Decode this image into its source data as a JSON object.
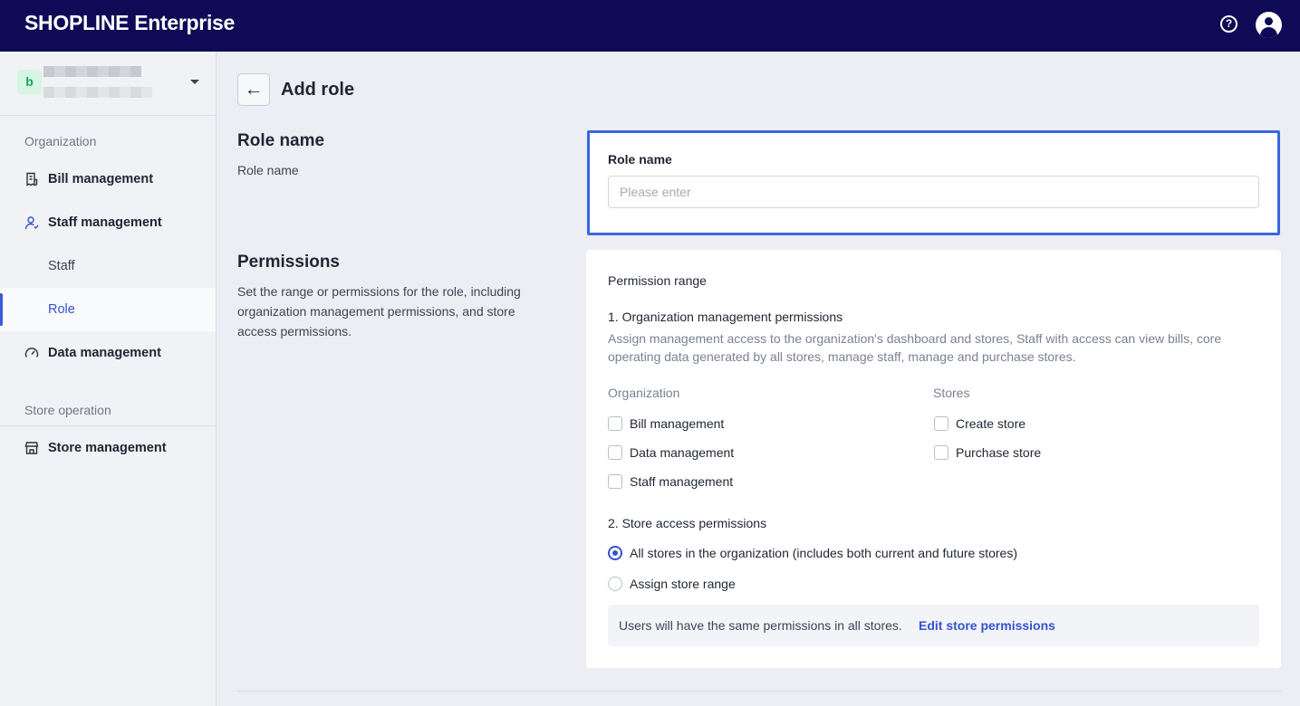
{
  "header": {
    "logo_main": "SHOPLINE",
    "logo_suffix": "Enterprise",
    "help_icon_glyph": "?",
    "avatar_icon": "user-avatar-icon"
  },
  "sidebar": {
    "org_badge": "b",
    "sections": [
      {
        "label": "Organization"
      },
      {
        "label": "Store operation"
      }
    ],
    "items": [
      {
        "label": "Bill management",
        "icon": "bill-icon"
      },
      {
        "label": "Staff management",
        "icon": "staff-icon"
      },
      {
        "label": "Staff"
      },
      {
        "label": "Role",
        "active": true
      },
      {
        "label": "Data management",
        "icon": "gauge-icon"
      },
      {
        "label": "Store management",
        "icon": "store-icon"
      }
    ]
  },
  "page": {
    "back_glyph": "←",
    "title": "Add role"
  },
  "role_section": {
    "title": "Role name",
    "desc": "Role name",
    "field_label": "Role name",
    "placeholder": "Please enter",
    "value": ""
  },
  "perm_section": {
    "title": "Permissions",
    "desc": "Set the range or permissions for the role, including organization management permissions, and store access permissions.",
    "range_label": "Permission range",
    "org_title": "1. Organization management permissions",
    "org_desc": "Assign management access to the organization's dashboard and stores, Staff with access can view bills, core operating data generated by all stores, manage staff, manage and purchase stores.",
    "col_org": "Organization",
    "col_stores": "Stores",
    "org_checks": [
      {
        "label": "Bill management",
        "checked": false
      },
      {
        "label": "Data management",
        "checked": false
      },
      {
        "label": "Staff management",
        "checked": false
      }
    ],
    "store_checks": [
      {
        "label": "Create store",
        "checked": false
      },
      {
        "label": "Purchase store",
        "checked": false
      }
    ],
    "store_title": "2. Store access permissions",
    "store_radios": [
      {
        "label": "All stores in the organization (includes both current and future stores)",
        "selected": true
      },
      {
        "label": "Assign store range",
        "selected": false
      }
    ],
    "info_text": "Users will have the same permissions in all stores.",
    "info_link": "Edit store permissions"
  },
  "colors": {
    "topbar": "#0e0a55",
    "accent": "#3452cf",
    "focus_border": "#3a67de"
  }
}
